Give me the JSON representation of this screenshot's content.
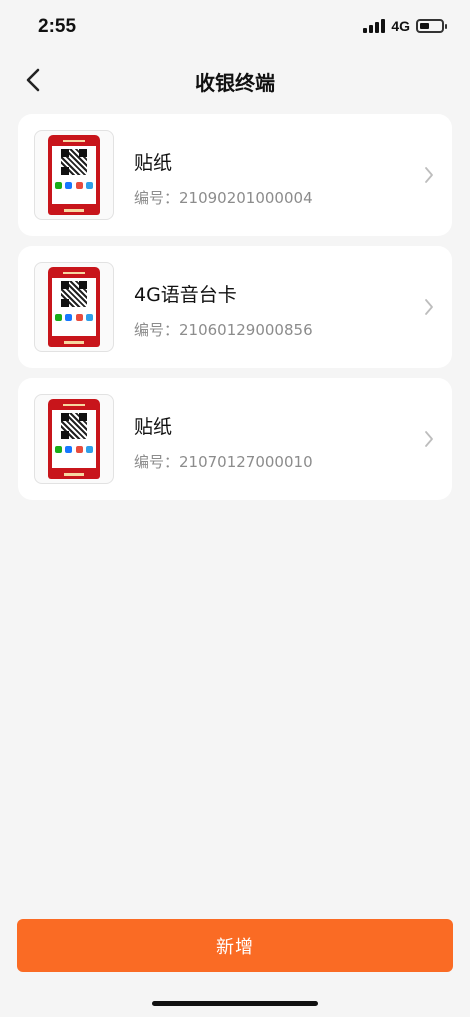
{
  "status_bar": {
    "time": "2:55",
    "network": "4G"
  },
  "nav": {
    "title": "收银终端"
  },
  "terminals": [
    {
      "name": "贴纸",
      "code": "编号：21090201000004"
    },
    {
      "name": "4G语音台卡",
      "code": "编号：21060129000856"
    },
    {
      "name": "贴纸",
      "code": "编号：21070127000010"
    }
  ],
  "actions": {
    "add_label": "新增"
  },
  "colors": {
    "accent": "#fa6b24",
    "stand_red": "#c8151b",
    "background": "#f5f5f5"
  }
}
